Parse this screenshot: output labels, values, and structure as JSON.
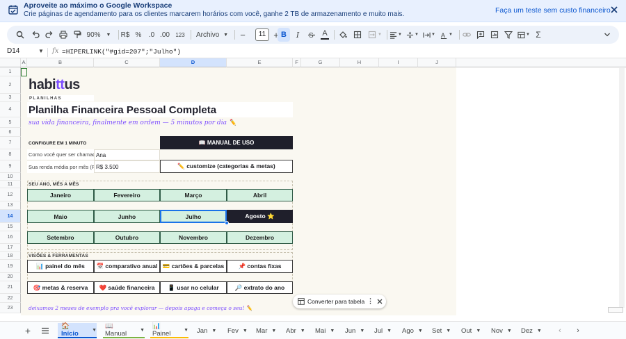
{
  "banner": {
    "title": "Aproveite ao máximo o Google Workspace",
    "subtitle": "Crie páginas de agendamento para os clientes marcarem horários com você, ganhe 2 TB de armazenamento e muito mais.",
    "cta": "Faça um teste sem custo financeiro"
  },
  "toolbar": {
    "zoom": "90%",
    "currency": "R$",
    "percent": "%",
    "dec_less": ".0",
    "dec_more": ".00",
    "number_format": "123",
    "font": "Archivo",
    "font_size": "11",
    "bold": "B",
    "italic": "I",
    "text_color_label": "A"
  },
  "formula_bar": {
    "cell_ref": "D14",
    "fx": "fx",
    "formula": "=HIPERLINK(\"#gid=207\";\"Julho\")"
  },
  "grid": {
    "columns": [
      "A",
      "B",
      "C",
      "D",
      "E",
      "F",
      "G",
      "H",
      "I",
      "J"
    ],
    "selected_column": "D",
    "rows": [
      "1",
      "2",
      "3",
      "4",
      "5",
      "6",
      "7",
      "8",
      "9",
      "10",
      "11",
      "12",
      "13",
      "14",
      "15",
      "16",
      "17",
      "18",
      "19",
      "20",
      "21",
      "22",
      "23"
    ],
    "selected_row": "14"
  },
  "sheet": {
    "logo": {
      "prefix": "habi",
      "highlight": "tt",
      "suffix": "us"
    },
    "brand_caption": "PLANILHAS",
    "title": "Planilha Financeira Pessoal Completa",
    "tagline": "sua vida financeira, finalmente em ordem — 5 minutos por dia ✏️",
    "config_header": "CONFIGURE EM 1 MINUTO",
    "manual_button": "📖 MANUAL DE USO",
    "name_label": "Como você quer ser chamad",
    "name_value": "Ana",
    "income_label": "Sua renda média por mês (R",
    "income_value": "R$ 3.500",
    "customize_button": "✏️ customize (categorias & metas)",
    "months_header": "SEU ANO, MÊS A MÊS",
    "months": [
      [
        "Janeiro",
        "Fevereiro",
        "Março",
        "Abril"
      ],
      [
        "Maio",
        "Junho",
        "Julho",
        "Agosto ⭐"
      ],
      [
        "Setembro",
        "Outubro",
        "Novembro",
        "Dezembro"
      ]
    ],
    "tools_header": "VISÕES & FERRAMENTAS",
    "tools": [
      [
        "📊 painel do mês",
        "📅 comparativo anual",
        "💳 cartões & parcelas",
        "📌 contas fixas"
      ],
      [
        "🎯 metas & reserva",
        "❤️ saúde financeira",
        "📱 usar no celular",
        "🔎 extrato do ano"
      ]
    ],
    "footer_note": "deixamos 2 meses de exemplo pra você explorar — depois apaga e começa o seu! ✏️"
  },
  "chip": {
    "label": "Converter para tabela"
  },
  "tabs": [
    {
      "label": "🏠 Início",
      "active": true
    },
    {
      "label": "📖 Manual"
    },
    {
      "label": "📊 Painel"
    },
    {
      "label": "Jan"
    },
    {
      "label": "Fev"
    },
    {
      "label": "Mar"
    },
    {
      "label": "Abr"
    },
    {
      "label": "Mai"
    },
    {
      "label": "Jun"
    },
    {
      "label": "Jul"
    },
    {
      "label": "Ago"
    },
    {
      "label": "Set"
    },
    {
      "label": "Out"
    },
    {
      "label": "Nov"
    },
    {
      "label": "Dez"
    }
  ],
  "colors": {
    "accent": "#7c4dff",
    "month_fill": "#d4f0e0",
    "dark_fill": "#1f1f2b",
    "selection": "#1a73e8"
  }
}
